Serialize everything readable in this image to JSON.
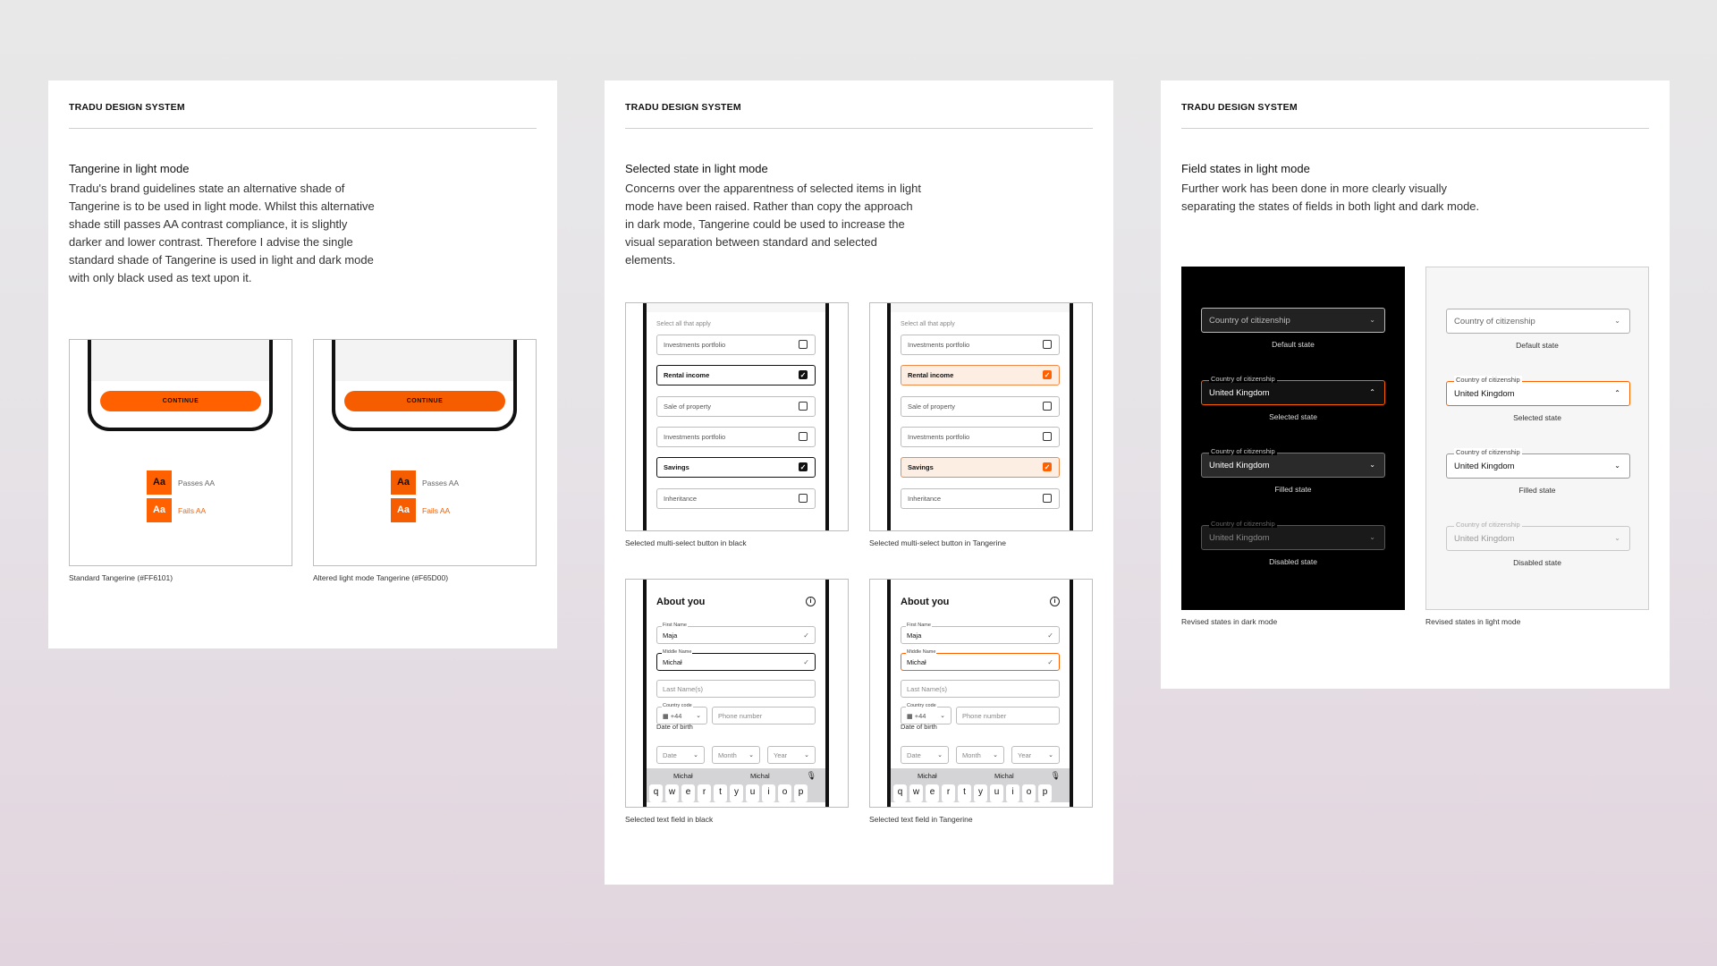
{
  "colors": {
    "standard_tangerine": "#FF6101",
    "altered_tangerine": "#F65D00",
    "black": "#111111"
  },
  "card1": {
    "brand": "TRADU DESIGN SYSTEM",
    "title": "Tangerine in light mode",
    "body": "Tradu's brand guidelines state an alternative shade of Tangerine is to be used in light mode. Whilst this alternative shade still passes AA contrast compliance, it is slightly darker and lower contrast. Therefore I advise the single standard shade of Tangerine is used in light and dark mode with only black used as text upon it.",
    "button_label": "CONTINUE",
    "swatch_text": "Aa",
    "passes_label": "Passes AA",
    "fails_label": "Fails AA",
    "caption_standard": "Standard Tangerine (#FF6101)",
    "caption_altered": "Altered light mode Tangerine (#F65D00)"
  },
  "card2": {
    "brand": "TRADU DESIGN SYSTEM",
    "title": "Selected state in light mode",
    "body": "Concerns over the apparentness of selected items in light mode have been raised. Rather than copy the approach in dark mode, Tangerine could be used to increase the visual separation between standard and selected elements.",
    "multiselect": {
      "label": "Select all that apply",
      "items": [
        "Investments portfolio",
        "Rental income",
        "Sale of property",
        "Investments portfolio",
        "Savings",
        "Inheritance"
      ],
      "check": "✓"
    },
    "caption_ms_black": "Selected multi-select button in black",
    "caption_ms_tan": "Selected multi-select button in Tangerine",
    "form": {
      "title": "About you",
      "info_icon": "i",
      "first_name_label": "First Name",
      "first_name_value": "Maja",
      "middle_name_label": "Middle Name",
      "middle_name_value": "Michał",
      "last_name_placeholder": "Last Name(s)",
      "country_code_label": "Country code",
      "country_code_value": "+44",
      "phone_placeholder": "Phone number",
      "dob_label": "Date of birth",
      "date_placeholder": "Date",
      "month_placeholder": "Month",
      "year_placeholder": "Year",
      "suggestion_1": "Michał",
      "suggestion_2": "Michal",
      "keys": [
        "q",
        "w",
        "e",
        "r",
        "t",
        "y",
        "u",
        "i",
        "o",
        "p"
      ]
    },
    "caption_tf_black": "Selected text field in black",
    "caption_tf_tan": "Selected text field in Tangerine"
  },
  "card3": {
    "brand": "TRADU DESIGN SYSTEM",
    "title": "Field states in light mode",
    "body": "Further work has been done in more clearly visually separating the states of fields in both light and dark mode.",
    "field_label": "Country of citizenship",
    "field_value": "United Kingdom",
    "state_default": "Default state",
    "state_selected": "Selected state",
    "state_filled": "Filled state",
    "state_disabled": "Disabled state",
    "caption_dark": "Revised states in dark mode",
    "caption_light": "Revised states in light mode"
  }
}
